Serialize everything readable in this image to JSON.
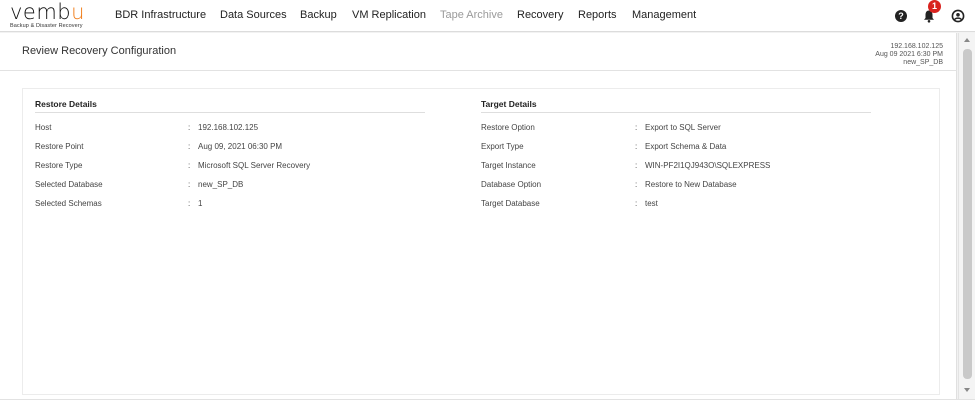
{
  "brand": {
    "name_prefix": "vemb",
    "name_accent": "u",
    "tagline": "Backup & Disaster Recovery"
  },
  "nav": {
    "items": [
      {
        "label": "BDR Infrastructure"
      },
      {
        "label": "Data Sources"
      },
      {
        "label": "Backup"
      },
      {
        "label": "VM Replication"
      },
      {
        "label": "Tape Archive"
      },
      {
        "label": "Recovery"
      },
      {
        "label": "Reports"
      },
      {
        "label": "Management"
      }
    ],
    "notification_count": "1",
    "icons": [
      "help-icon",
      "bell-icon",
      "user-icon"
    ]
  },
  "page": {
    "title": "Review Recovery Configuration",
    "meta": {
      "host": "192.168.102.125",
      "date": "Aug 09 2021 6:30 PM",
      "database": "new_SP_DB"
    }
  },
  "restore_details": {
    "title": "Restore Details",
    "rows": [
      {
        "label": "Host",
        "value": "192.168.102.125"
      },
      {
        "label": "Restore Point",
        "value": "Aug 09, 2021 06:30 PM"
      },
      {
        "label": "Restore Type",
        "value": "Microsoft SQL Server Recovery"
      },
      {
        "label": "Selected Database",
        "value": "new_SP_DB"
      },
      {
        "label": "Selected Schemas",
        "value": "1"
      }
    ]
  },
  "target_details": {
    "title": "Target Details",
    "rows": [
      {
        "label": "Restore Option",
        "value": "Export to SQL Server"
      },
      {
        "label": "Export Type",
        "value": "Export Schema & Data"
      },
      {
        "label": "Target Instance",
        "value": "WIN-PF2I1QJ943O\\SQLEXPRESS"
      },
      {
        "label": "Database Option",
        "value": "Restore to New Database"
      },
      {
        "label": "Target Database",
        "value": "test"
      }
    ]
  },
  "colon": ":",
  "colors": {
    "accent": "#f07d1a",
    "badge": "#d9231f"
  }
}
